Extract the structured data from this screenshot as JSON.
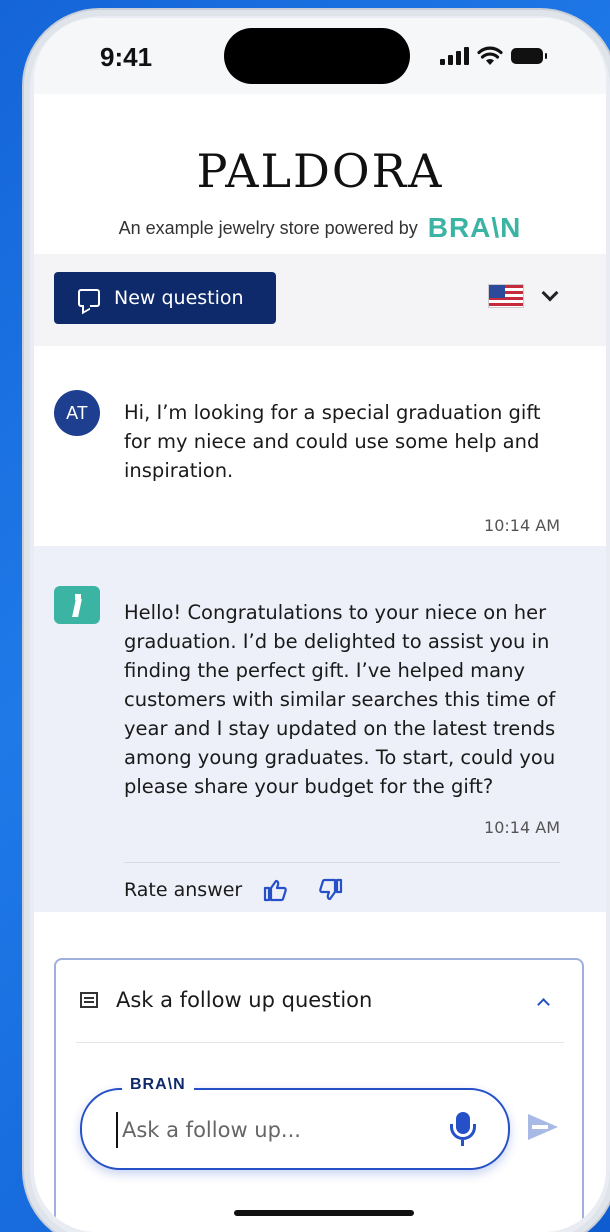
{
  "status_bar": {
    "time": "9:41"
  },
  "header": {
    "brand": "PALDORA",
    "subtitle": "An example jewelry store powered by",
    "logo_text": "BRA\\N"
  },
  "toolbar": {
    "new_question_label": "New question",
    "language": "United States flag"
  },
  "messages": [
    {
      "sender": "user",
      "avatar_initials": "AT",
      "text": "Hi, I’m looking for a special graduation gift for my niece and could use some help and inspiration.",
      "time": "10:14 AM"
    },
    {
      "sender": "assistant",
      "text": "Hello! Congratulations to your niece on her graduation. I’d be delighted to assist you in finding the perfect gift. I’ve helped many customers with similar searches this time of year and I stay updated on the latest trends among young graduates. To start, could you please share your budget for the gift?",
      "time": "10:14 AM",
      "rate_label": "Rate answer"
    }
  ],
  "followup": {
    "title": "Ask a follow up question",
    "input_legend": "BRA\\N",
    "input_placeholder": "Ask a follow up..."
  },
  "colors": {
    "primary": "#0e2a6b",
    "accent": "#2550c8",
    "brand_teal": "#3bb4a3",
    "bot_bg": "#edf0f8"
  },
  "icons": [
    "chat-icon",
    "flag-us-icon",
    "chevron-down-icon",
    "thumbs-up-icon",
    "thumbs-down-icon",
    "document-icon",
    "chevron-up-icon",
    "microphone-icon",
    "send-icon"
  ]
}
